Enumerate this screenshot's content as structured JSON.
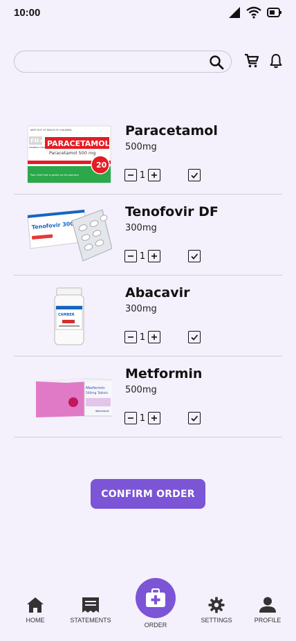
{
  "status_bar": {
    "time": "10:00"
  },
  "search": {
    "placeholder": ""
  },
  "items": [
    {
      "name": "Paracetamol",
      "dose": "500mg",
      "qty": "1",
      "checked": true,
      "pack_text": [
        "KEEP OUT OF REACH OF CHILDREN",
        "PARACETAMOL",
        "Paracetamol 500 mg",
        "20",
        "Pain relief that is gentle on the stomach",
        "FH+",
        "PHARMACY HEALTH"
      ]
    },
    {
      "name": "Tenofovir DF",
      "dose": "300mg",
      "qty": "1",
      "checked": true,
      "pack_text": [
        "Tenofovir 300"
      ]
    },
    {
      "name": "Abacavir",
      "dose": "300mg",
      "qty": "1",
      "checked": true,
      "pack_text": [
        "CAMBER"
      ]
    },
    {
      "name": "Metformin",
      "dose": "500mg",
      "qty": "1",
      "checked": true,
      "pack_text": [
        "Metformin",
        "500mg Tablets",
        "Wockhardt"
      ]
    }
  ],
  "confirm_label": "CONFIRM ORDER",
  "nav": {
    "home": "HOME",
    "statements": "STATEMENTS",
    "order": "ORDER",
    "settings": "SETTINGS",
    "profile": "PROFILE"
  },
  "colors": {
    "accent": "#7b55d6",
    "background": "#f4f0fc"
  }
}
